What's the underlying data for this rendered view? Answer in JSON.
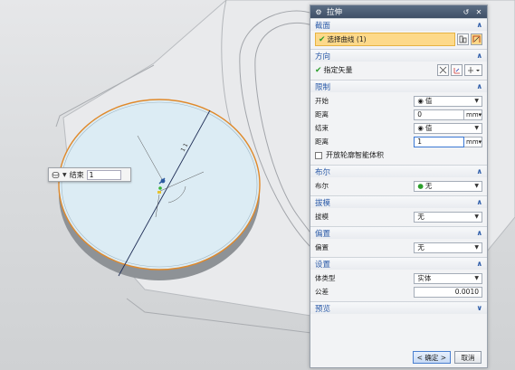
{
  "dialog": {
    "title": "拉伸",
    "sections": {
      "section": {
        "title": "截面",
        "select_curve": "选择曲线 (1)"
      },
      "direction": {
        "title": "方向",
        "specify_vector": "指定矢量"
      },
      "limits": {
        "title": "限制",
        "start_label": "开始",
        "start_value": "值",
        "dist1_label": "距离",
        "dist1_value": "0",
        "dist1_unit": "mm",
        "end_label": "结束",
        "end_value": "值",
        "dist2_label": "距离",
        "dist2_value": "1",
        "dist2_unit": "mm",
        "open_profile_label": "开放轮廓智能体积"
      },
      "boolean": {
        "title": "布尔",
        "label": "布尔",
        "value": "无"
      },
      "draft": {
        "title": "拔模",
        "label": "拔模",
        "value": "无"
      },
      "offset": {
        "title": "偏置",
        "label": "偏置",
        "value": "无"
      },
      "settings": {
        "title": "设置",
        "body_type_label": "体类型",
        "body_type_value": "实体",
        "tolerance_label": "公差",
        "tolerance_value": "0.0010"
      },
      "preview": {
        "title": "预览"
      }
    },
    "buttons": {
      "ok": "< 确定 >",
      "cancel": "取消"
    }
  },
  "float_widget": {
    "label": "结束",
    "value": "1"
  },
  "viewport": {
    "dimension_label": "1 1"
  },
  "colors": {
    "accent": "#2a5aa8",
    "selection": "#fdd98a",
    "titlebar": "#3f4f66",
    "disc": "#dff0f8",
    "edge": "#e0892a"
  }
}
